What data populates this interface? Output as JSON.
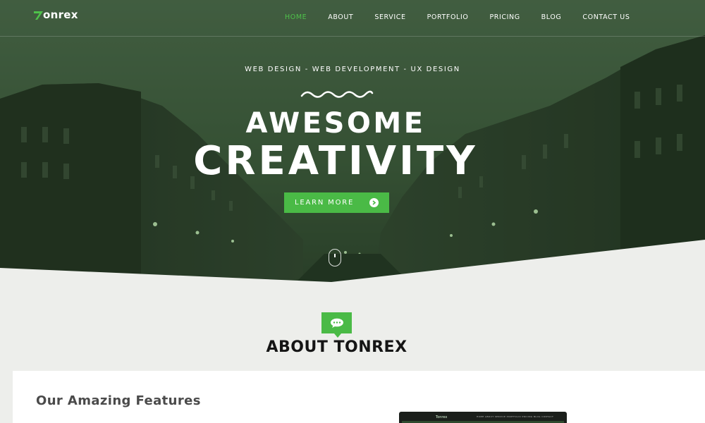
{
  "brand": {
    "name": "onrex",
    "accent_color": "#4aba46",
    "logo_icon": "seven-mark-icon"
  },
  "nav": {
    "items": [
      {
        "label": "HOME",
        "active": true
      },
      {
        "label": "ABOUT",
        "active": false
      },
      {
        "label": "SERVICE",
        "active": false
      },
      {
        "label": "PORTFOLIO",
        "active": false
      },
      {
        "label": "PRICING",
        "active": false
      },
      {
        "label": "BLOG",
        "active": false
      },
      {
        "label": "CONTACT US",
        "active": false
      }
    ]
  },
  "hero": {
    "tagline": "WEB DESIGN - WEB DEVELOPMENT - UX DESIGN",
    "title_line1": "AWESOME",
    "title_line2": "CREATIVITY",
    "cta_label": "LEARN MORE",
    "cta_icon": "chevron-right-circle-icon",
    "scroll_icon": "mouse-scroll-icon",
    "decor_icon": "wave-squiggle-icon"
  },
  "about": {
    "icon": "chat-bubble-icon",
    "title": "ABOUT TONREX",
    "features_title": "Our Amazing Features"
  },
  "preview": {
    "logo": "Tonrex",
    "nav": "HOME  ABOUT  SERVICE  PORTFOLIO  PRICING  BLOG  CONTACT"
  }
}
